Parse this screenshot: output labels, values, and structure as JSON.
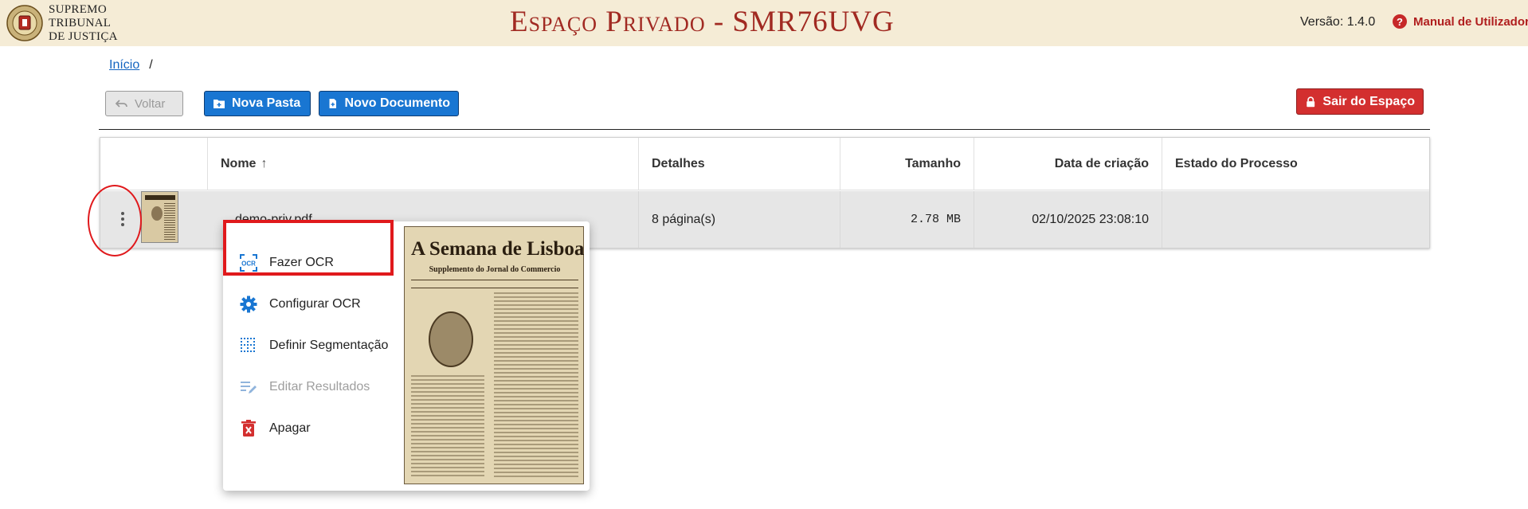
{
  "header": {
    "logo_lines": [
      "SUPREMO",
      "TRIBUNAL",
      "DE JUSTIÇA"
    ],
    "title": "Espaço Privado - SMR76UVG",
    "version": "Versão: 1.4.0",
    "manual_label": "Manual de Utilizador"
  },
  "breadcrumb": {
    "home": "Início",
    "separator": "/"
  },
  "toolbar": {
    "back_label": "Voltar",
    "new_folder_label": "Nova Pasta",
    "new_document_label": "Novo Documento",
    "exit_label": "Sair do Espaço"
  },
  "table": {
    "columns": [
      "Nome",
      "Detalhes",
      "Tamanho",
      "Data de criação",
      "Estado do Processo"
    ],
    "rows": [
      {
        "name": "demo-priv.pdf",
        "details": "8 página(s)",
        "size": "2.78 MB",
        "created": "02/10/2025 23:08:10",
        "status": ""
      }
    ]
  },
  "context_menu": {
    "items": [
      {
        "label": "Fazer OCR",
        "icon": "ocr-icon",
        "enabled": true
      },
      {
        "label": "Configurar OCR",
        "icon": "gear-icon",
        "enabled": true
      },
      {
        "label": "Definir Segmentação",
        "icon": "segmentation-grid-icon",
        "enabled": true
      },
      {
        "label": "Editar Resultados",
        "icon": "edit-notes-icon",
        "enabled": false
      },
      {
        "label": "Apagar",
        "icon": "trash-icon",
        "enabled": true
      }
    ],
    "preview": {
      "title": "A Semana de Lisboa",
      "subtitle": "Supplemento do Jornal do Commercio"
    }
  },
  "colors": {
    "header_bg": "#f5ecd6",
    "title_red": "#a12a22",
    "primary_blue": "#1976d2",
    "danger_red": "#d32f2f",
    "annotation_red": "#e0191c"
  }
}
